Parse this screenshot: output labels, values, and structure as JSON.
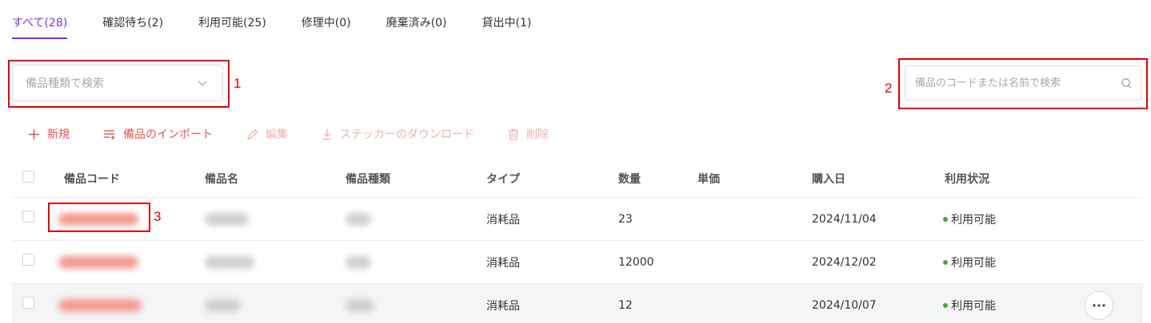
{
  "tabs": [
    {
      "label": "すべて(28)",
      "active": true
    },
    {
      "label": "確認待ち(2)",
      "active": false
    },
    {
      "label": "利用可能(25)",
      "active": false
    },
    {
      "label": "修理中(0)",
      "active": false
    },
    {
      "label": "廃棄済み(0)",
      "active": false
    },
    {
      "label": "貸出中(1)",
      "active": false
    }
  ],
  "filter": {
    "category_placeholder": "備品種類で検索",
    "search_placeholder": "備品のコードまたは名前で検索"
  },
  "annotations": [
    "1",
    "2",
    "3"
  ],
  "toolbar": {
    "new_label": "新規",
    "import_label": "備品のインポート",
    "edit_label": "編集",
    "download_label": "ステッカーのダウンロード",
    "delete_label": "削除"
  },
  "table": {
    "columns": [
      "備品コード",
      "備品名",
      "備品種類",
      "タイプ",
      "数量",
      "単価",
      "購入日",
      "利用状況"
    ],
    "rows": [
      {
        "type": "消耗品",
        "quantity": "23",
        "unit_price": "",
        "purchase_date": "2024/11/04",
        "status": "利用可能"
      },
      {
        "type": "消耗品",
        "quantity": "12000",
        "unit_price": "",
        "purchase_date": "2024/12/02",
        "status": "利用可能"
      },
      {
        "type": "消耗品",
        "quantity": "12",
        "unit_price": "",
        "purchase_date": "2024/10/07",
        "status": "利用可能"
      }
    ]
  },
  "colors": {
    "accent": "#7b2ff7",
    "action": "#e0584f",
    "action_disabled": "#efb1aa",
    "annotation": "#e30000",
    "status_ok": "#3fae2c"
  },
  "icons": [
    "plus-icon",
    "list-import-icon",
    "pencil-icon",
    "download-icon",
    "trash-icon",
    "chevron-down-icon",
    "search-icon",
    "more-icon"
  ]
}
